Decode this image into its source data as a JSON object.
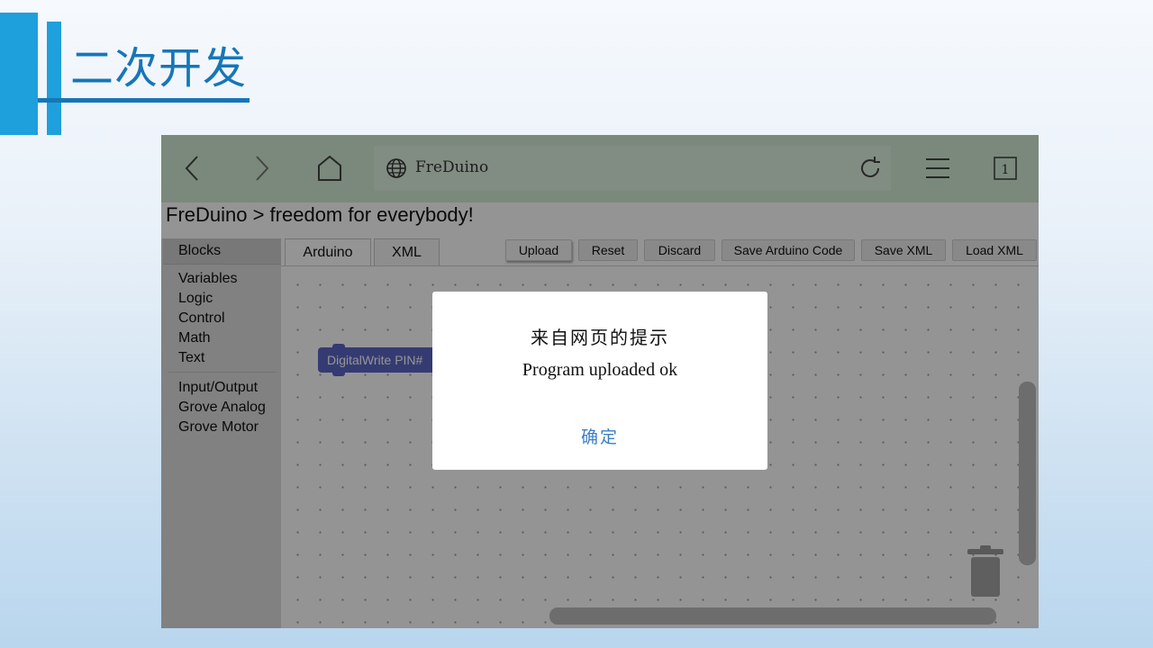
{
  "slide": {
    "title": "二次开发",
    "accent_color": "#1ea0dd",
    "title_color": "#1676b8"
  },
  "browser": {
    "url_title": "FreDuino",
    "tab_count": "1",
    "icons": [
      "back-icon",
      "forward-icon",
      "home-icon",
      "globe-icon",
      "reload-icon",
      "menu-icon",
      "tabs-icon"
    ],
    "toolbar_color": "#d2ecd4"
  },
  "page": {
    "heading": "FreDuino > freedom for everybody!",
    "sidebar": {
      "header": "Blocks",
      "categories": [
        "Variables",
        "Logic",
        "Control",
        "Math",
        "Text",
        "Input/Output",
        "Grove Analog",
        "Grove Motor"
      ]
    },
    "tabs": [
      "Arduino",
      "XML"
    ],
    "active_tab": "Arduino",
    "toolbar": {
      "upload": "Upload",
      "reset": "Reset",
      "discard": "Discard",
      "save_arduino": "Save Arduino Code",
      "save_xml": "Save XML",
      "load_xml": "Load XML"
    },
    "workspace": {
      "block_label": "DigitalWrite PIN#",
      "block_color": "#5b67c5"
    }
  },
  "dialog": {
    "title": "来自网页的提示",
    "message": "Program uploaded ok",
    "ok_label": "确定",
    "ok_color": "#3d7ec4"
  }
}
